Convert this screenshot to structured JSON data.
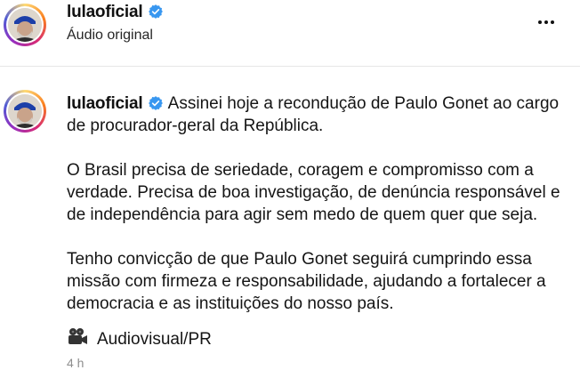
{
  "header": {
    "username": "lulaoficial",
    "subtitle": "Áudio original",
    "more_icon": "more-horizontal-icon"
  },
  "post": {
    "username": "lulaoficial",
    "paragraphs": [
      "Assinei hoje a recondução de Paulo Gonet ao cargo de procurador-geral da República.",
      "O Brasil precisa de seriedade, coragem e compromisso com a verdade. Precisa de boa investigação, de denúncia responsável e de independência para agir sem medo de quem quer que seja.",
      "Tenho convicção de que Paulo Gonet seguirá cumprindo essa missão com firmeza e responsabilidade, ajudando a fortalecer a democracia e as instituições do nosso país."
    ],
    "credit_icon": "movie-camera-icon",
    "credit": "Audiovisual/PR",
    "timestamp": "4 h"
  },
  "colors": {
    "verified": "#3897f0",
    "muted": "#8e8e8e"
  }
}
